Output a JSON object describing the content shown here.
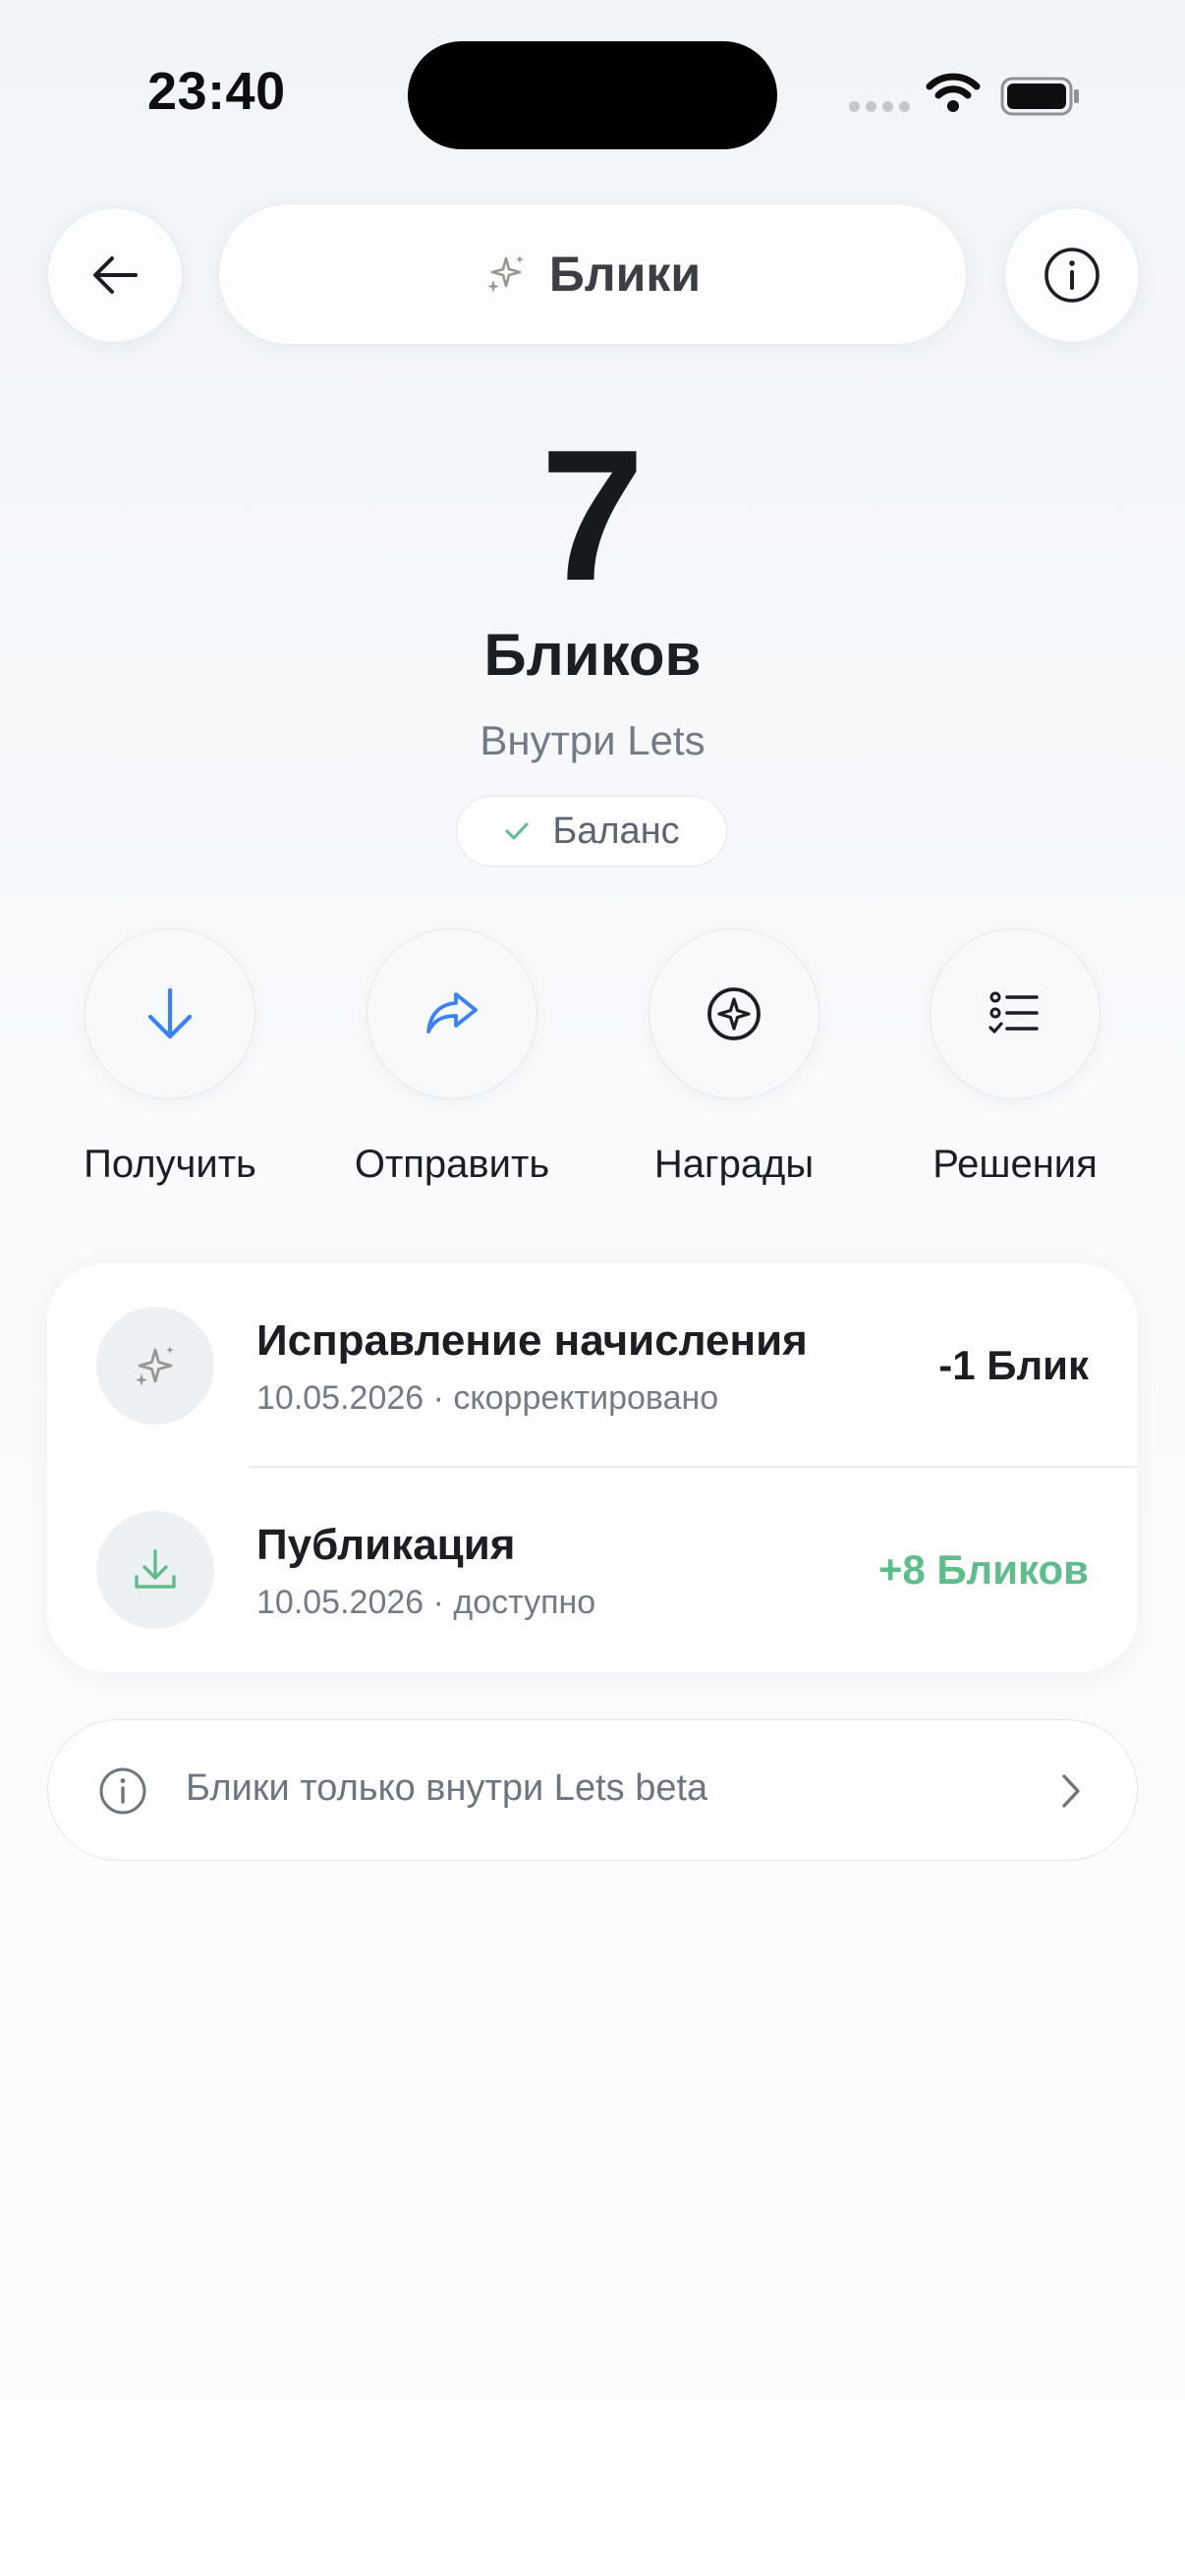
{
  "status_bar": {
    "time": "23:40"
  },
  "header": {
    "title": "Блики",
    "back_icon": "arrow-left-icon",
    "info_icon": "info-circle-icon",
    "title_icon": "sparkles-icon"
  },
  "balance": {
    "value": "7",
    "unit": "Бликов",
    "subtitle": "Внутри Lets",
    "badge": "Баланс"
  },
  "actions": [
    {
      "label": "Получить",
      "icon": "arrow-down-icon",
      "color": "#3b82f6"
    },
    {
      "label": "Отправить",
      "icon": "share-arrow-icon",
      "color": "#3b82f6"
    },
    {
      "label": "Награды",
      "icon": "star-badge-icon",
      "color": "#1b1e23"
    },
    {
      "label": "Решения",
      "icon": "checklist-icon",
      "color": "#1b1e23"
    }
  ],
  "transactions": [
    {
      "title": "Исправление начисления",
      "subtitle": "10.05.2026 · скорректировано",
      "amount": "-1 Блик",
      "amount_color": "#1b1e23",
      "icon": "sparkles-icon"
    },
    {
      "title": "Публикация",
      "subtitle": "10.05.2026 · доступно",
      "amount": "+8 Бликов",
      "amount_color": "#5ebd8a",
      "icon": "download-tray-icon"
    }
  ],
  "info_banner": {
    "text": "Блики только внутри Lets beta",
    "icon": "info-circle-icon",
    "chevron": "chevron-right-icon"
  },
  "colors": {
    "accent_blue": "#3b82f6",
    "positive_green": "#5ebd8a",
    "muted_text": "#737b86"
  }
}
